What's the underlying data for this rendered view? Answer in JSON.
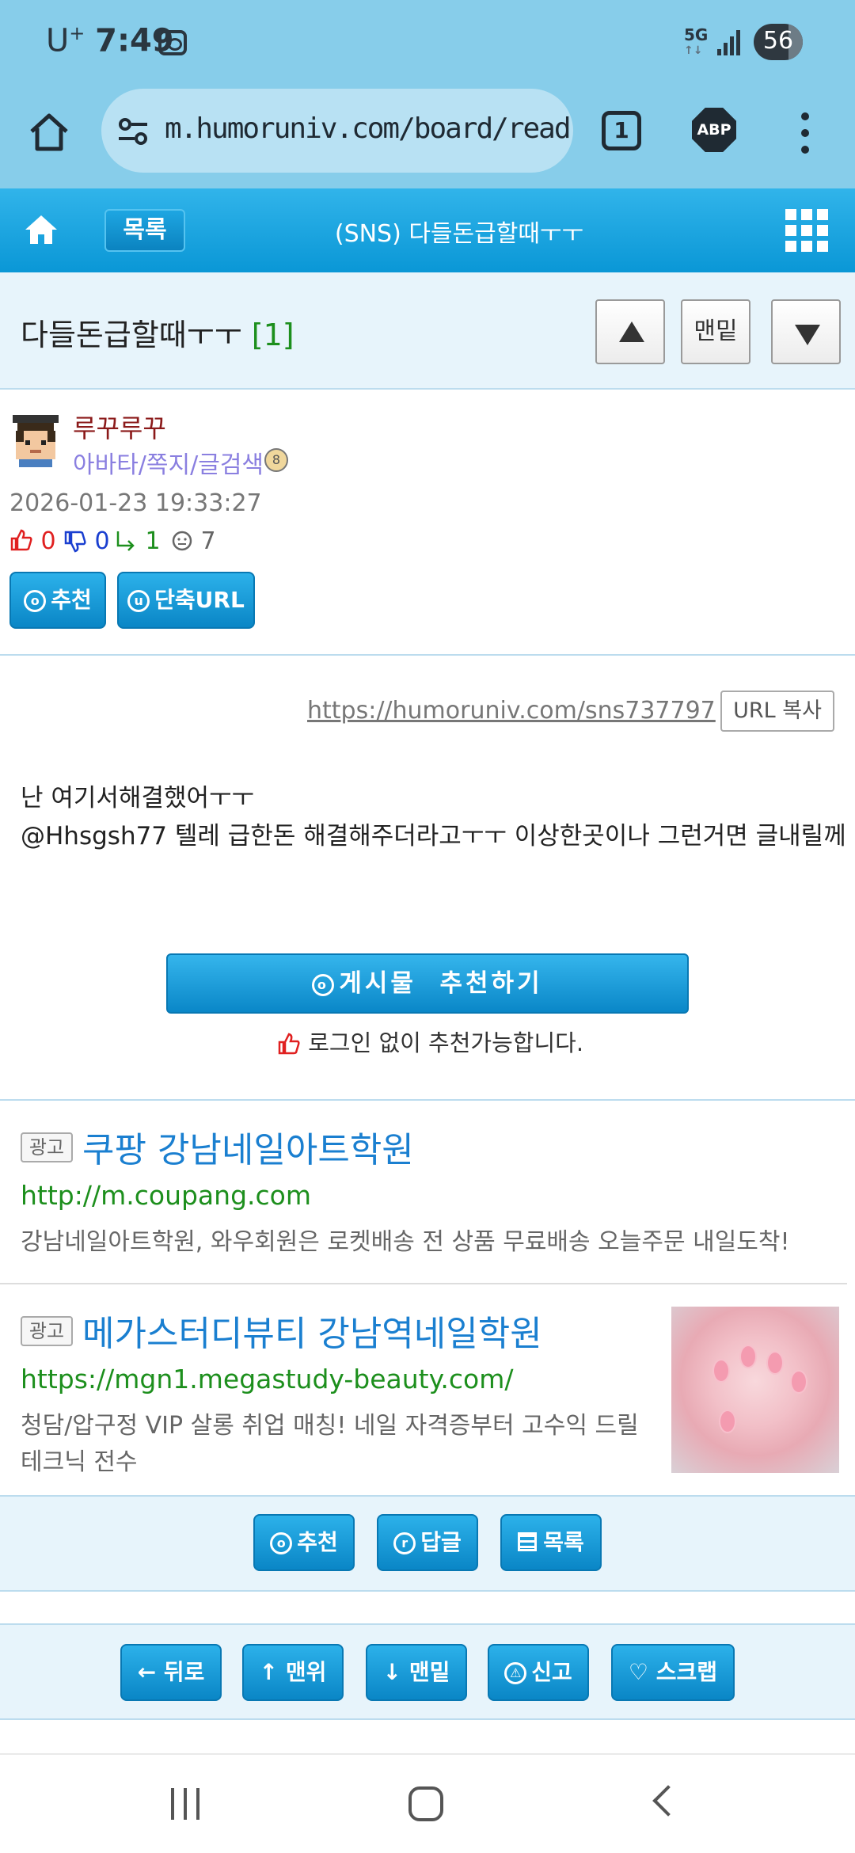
{
  "status_bar": {
    "carrier": "U",
    "carrier_plus": "+",
    "time": "7:49",
    "network": "5G",
    "battery": "56"
  },
  "browser": {
    "url": "m.humoruniv.com/board/read",
    "tab_count": "1",
    "adblock_label": "ABP"
  },
  "site_header": {
    "list_label": "목록",
    "title": "(SNS) 다들돈급할때ㅜㅜ"
  },
  "post": {
    "title": "다들돈급할때ㅜㅜ",
    "comment_count": "[1]",
    "nav_bottom_label": "맨밑",
    "author": "루꾸루꾸",
    "author_links": "아바타/쪽지/글검색",
    "level_badge": "8",
    "date": "2026-01-23 19:33:27",
    "stats": {
      "likes": "0",
      "dislikes": "0",
      "replies": "1",
      "views": "7"
    },
    "recommend_label": "추천",
    "short_url_label": "단축URL",
    "short_url": "https://humoruniv.com/sns737797",
    "copy_url_label": "URL 복사",
    "body": [
      "난 여기서해결했어ㅜㅜ",
      "@Hhsgsh77 텔레 급한돈 해결해주더라고ㅜㅜ 이상한곳이나 그런거면 글내릴께"
    ],
    "recommend_big_label": "게시물  추천하기",
    "recommend_note": "로그인 없이 추천가능합니다."
  },
  "ads": [
    {
      "tag": "광고",
      "title": "쿠팡 강남네일아트학원",
      "url": "http://m.coupang.com",
      "desc": "강남네일아트학원, 와우회원은 로켓배송 전 상품 무료배송 오늘주문 내일도착!"
    },
    {
      "tag": "광고",
      "title": "메가스터디뷰티 강남역네일학원",
      "url": "https://mgn1.megastudy-beauty.com/",
      "desc_lines": [
        "청담/압구정 VIP 살롱 취업 매칭! 네일 자격증부터 고수익 드릴",
        "테크닉 전수"
      ]
    }
  ],
  "action_bar": {
    "recommend": "추천",
    "reply": "답글",
    "list": "목록",
    "recommend_icon": "o",
    "reply_icon": "r"
  },
  "nav_buttons": {
    "back": "← 뒤로",
    "top": "↑ 맨위",
    "bottom": "↓ 맨밑",
    "report": "신고",
    "scrap": "♡ 스크랩"
  },
  "colors": {
    "chrome": "#87cdea",
    "header_blue": "#0a97d6",
    "button_blue": "#1a9bd8",
    "author_name": "#8b1a1a",
    "ad_title": "#1a7fd0",
    "ad_url": "#1d8f1d"
  }
}
